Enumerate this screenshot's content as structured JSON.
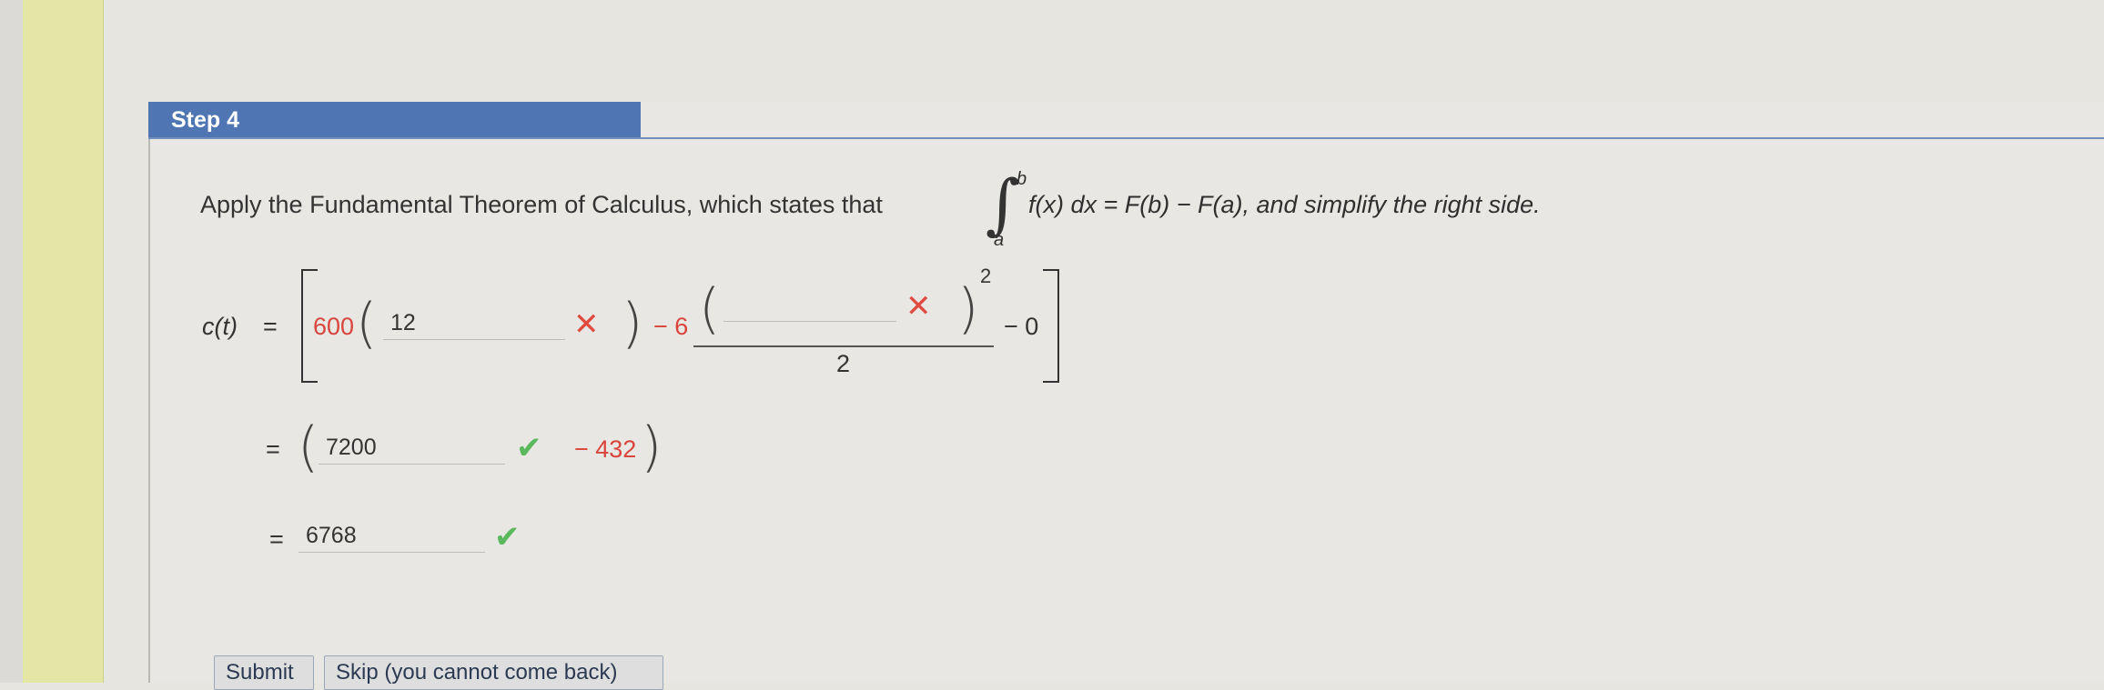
{
  "step": {
    "title": "Step 4"
  },
  "intro": {
    "text_before": "Apply the Fundamental Theorem of Calculus, which states that",
    "upper_limit": "b",
    "lower_limit": "a",
    "formula": "f(x) dx = F(b) − F(a), and simplify the right side."
  },
  "equation": {
    "lhs": "c(t)",
    "equals": "=",
    "coef1": "600",
    "box1_value": "12",
    "box1_status": "incorrect",
    "minus6": "− 6",
    "box2_value": "",
    "box2_status": "incorrect",
    "exponent": "2",
    "denominator": "2",
    "minus0": "− 0"
  },
  "line2": {
    "equals": "=",
    "box_value": "7200",
    "box_status": "correct",
    "minus_term": "− 432"
  },
  "line3": {
    "equals": "=",
    "box_value": "6768",
    "box_status": "correct"
  },
  "buttons": {
    "submit": "Submit",
    "skip": "Skip (you cannot come back)"
  },
  "colors": {
    "header_bg": "#4f76b3",
    "incorrect": "#e04a40",
    "correct": "#5cb85c"
  }
}
